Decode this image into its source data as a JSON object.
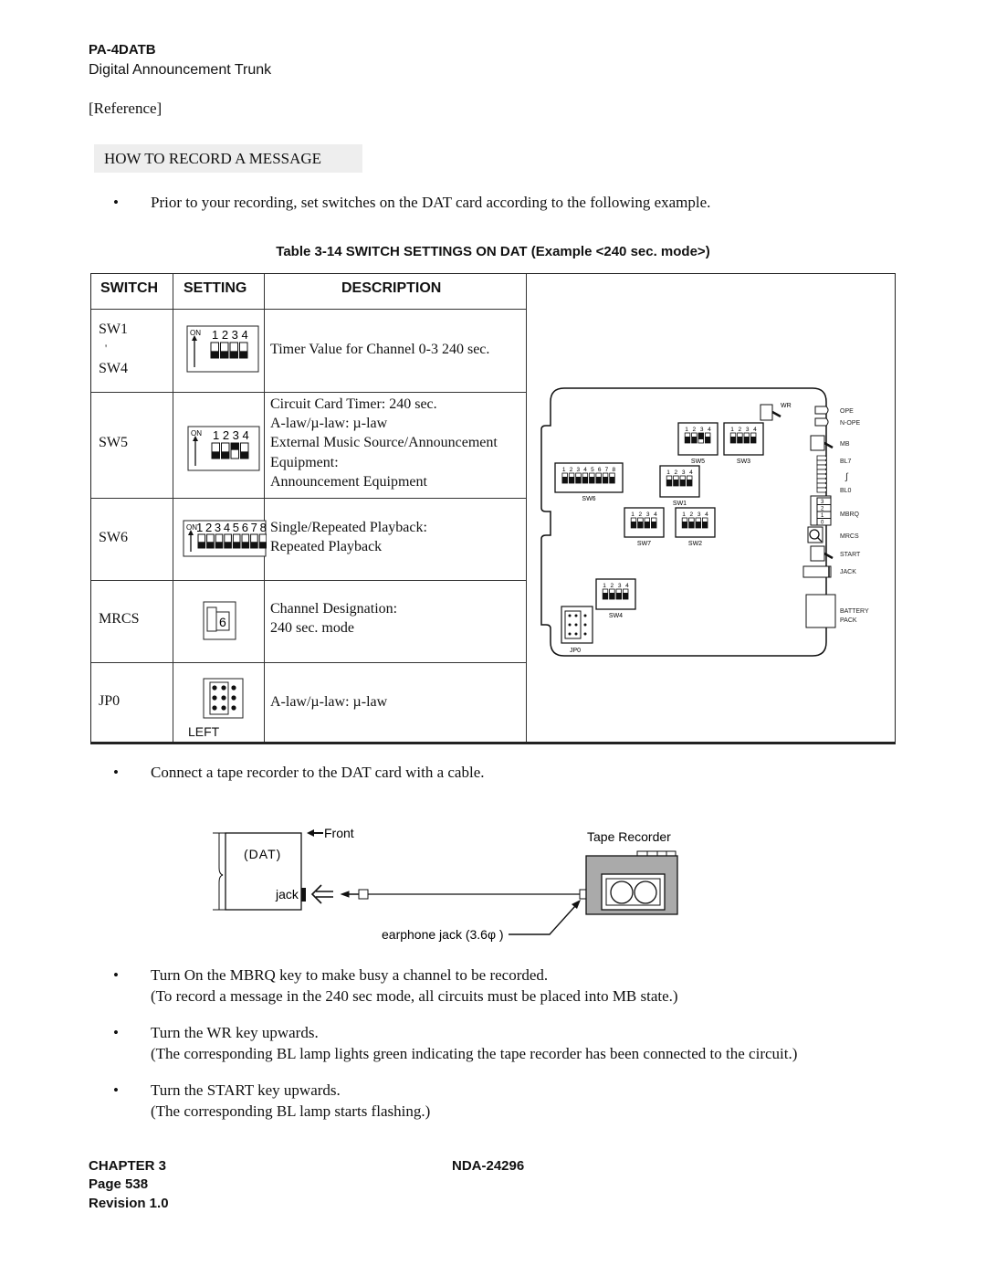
{
  "header": {
    "title": "PA-4DATB",
    "subtitle": "Digital Announcement Trunk"
  },
  "reference_label": "[Reference]",
  "section_title": "HOW TO RECORD A MESSAGE",
  "intro_bullet": "Prior to your recording, set switches on the DAT card according to the following example.",
  "table": {
    "caption": "Table 3-14 SWITCH SETTINGS ON DAT (Example <240 sec. mode>)",
    "headers": [
      "SWITCH",
      "SETTING",
      "DESCRIPTION"
    ],
    "rows": [
      {
        "switch": [
          "SW1",
          "'",
          "SW4"
        ],
        "on_label": "ON",
        "numbers": "1 2 3 4",
        "positions": [
          "off",
          "off",
          "off",
          "off"
        ],
        "description": [
          "Timer Value for Channel 0-3 240 sec."
        ]
      },
      {
        "switch": [
          "SW5"
        ],
        "on_label": "ON",
        "numbers": "1 2 3 4",
        "positions": [
          "off",
          "off",
          "on",
          "off"
        ],
        "description": [
          "Circuit Card Timer: 240 sec.",
          "A-law/µ-law: µ-law",
          "External Music Source/Announcement",
          "Equipment:",
          "Announcement Equipment"
        ]
      },
      {
        "switch": [
          "SW6"
        ],
        "on_label": "ON",
        "numbers": "12345678",
        "positions": [
          "off",
          "off",
          "off",
          "off",
          "off",
          "off",
          "off",
          "off"
        ],
        "description": [
          "Single/Repeated Playback:",
          "Repeated Playback"
        ]
      },
      {
        "switch": [
          "MRCS"
        ],
        "value": "6",
        "description": [
          "Channel Designation:",
          "240 sec. mode"
        ]
      },
      {
        "switch": [
          "JP0"
        ],
        "jumper_label": "LEFT",
        "description": [
          "A-law/µ-law: µ-law"
        ]
      }
    ]
  },
  "card_diagram": {
    "switches": [
      {
        "label": "SW5",
        "numbers": "1 2 3 4",
        "positions": [
          "off",
          "off",
          "on",
          "off"
        ]
      },
      {
        "label": "SW3",
        "numbers": "1 2 3 4",
        "positions": [
          "off",
          "off",
          "off",
          "off"
        ]
      },
      {
        "label": "SW6",
        "numbers": "1 2 3 4 5 6 7 8",
        "positions": [
          "off",
          "off",
          "off",
          "off",
          "off",
          "off",
          "off",
          "off"
        ]
      },
      {
        "label": "SW1",
        "numbers": "1 2 3 4",
        "positions": [
          "off",
          "off",
          "off",
          "off"
        ]
      },
      {
        "label": "SW7",
        "numbers": "1 2 3 4",
        "positions": [
          "off",
          "off",
          "off",
          "off"
        ]
      },
      {
        "label": "SW2",
        "numbers": "1 2 3 4",
        "positions": [
          "off",
          "off",
          "off",
          "off"
        ]
      },
      {
        "label": "SW4",
        "numbers": "1 2 3 4",
        "positions": [
          "off",
          "off",
          "off",
          "off"
        ]
      }
    ],
    "jumper": "JP0",
    "wr": "WR",
    "front_labels": {
      "ope": "OPE",
      "nope": "N-OPE",
      "mb": "MB",
      "bl7": "BL7",
      "tilde": "∫",
      "bl0": "BL0",
      "mbrq": "MBRQ",
      "mbrq_numbers": [
        "3",
        "2",
        "1",
        "0"
      ],
      "mrcs": "MRCS",
      "start": "START",
      "jack": "JACK",
      "battery1": "BATTERY",
      "battery2": "PACK"
    }
  },
  "connect_bullet": "Connect a tape recorder to the DAT card with a cable.",
  "connection_diagram": {
    "dat": "(DAT)",
    "jack": "jack",
    "front": "Front",
    "recorder": "Tape Recorder",
    "earphone": "earphone jack (3.6φ )"
  },
  "steps": [
    {
      "pre": "Turn On the ",
      "key": "MBRQ",
      "post": " key to make busy a channel to be recorded.",
      "note": "(To record a message in the 240 sec mode, all circuits must be placed into MB state.)"
    },
    {
      "pre": "Turn the ",
      "key": "WR",
      "post": " key upwards.",
      "note": "(The corresponding BL lamp lights green indicating the tape recorder has been connected to the circuit.)"
    },
    {
      "pre": "Turn the ",
      "key": "START",
      "post": " key upwards.",
      "note": "(The corresponding BL lamp starts flashing.)"
    }
  ],
  "footer": {
    "chapter": "CHAPTER 3",
    "doc": "NDA-24296",
    "page": "Page 538",
    "revision": "Revision 1.0"
  }
}
